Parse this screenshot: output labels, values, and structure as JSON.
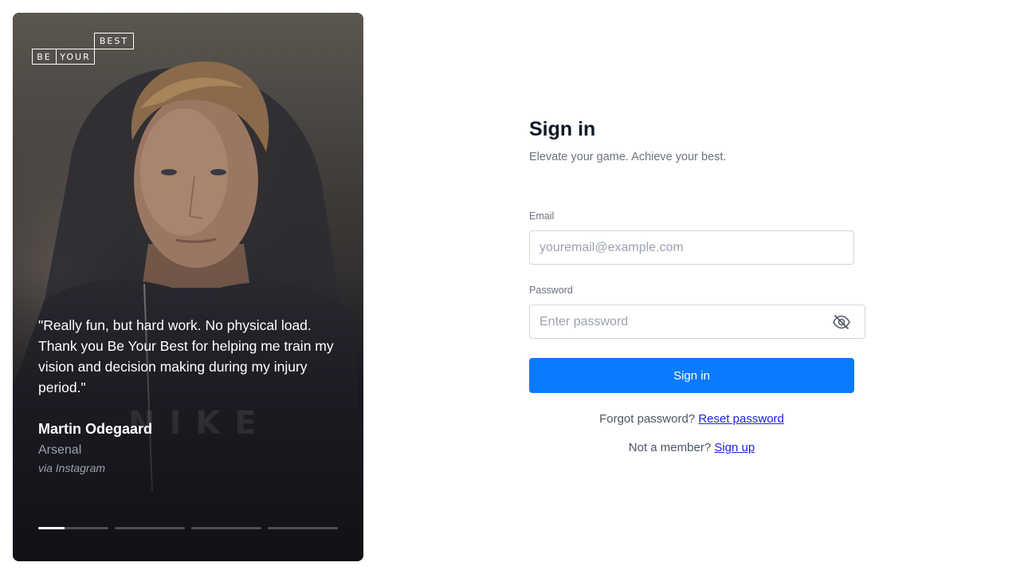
{
  "hero": {
    "logo": {
      "top": "BEST",
      "left": "BE",
      "middle": "YOUR"
    },
    "quote": "\"Really fun, but hard work. No physical load. Thank you Be Your Best for helping me train my vision and decision making during my injury period.\"",
    "author": {
      "name": "Martin Odegaard",
      "club": "Arsenal",
      "source": "via Instagram"
    },
    "carousel": {
      "total": 4,
      "active_index": 0,
      "active_progress": 0.38
    }
  },
  "form": {
    "title": "Sign in",
    "subtitle": "Elevate your game. Achieve your best.",
    "email": {
      "label": "Email",
      "placeholder": "youremail@example.com",
      "value": ""
    },
    "password": {
      "label": "Password",
      "placeholder": "Enter password",
      "value": "",
      "toggle_icon": "eye-slash-icon"
    },
    "submit_label": "Sign in",
    "forgot": {
      "text": "Forgot password?",
      "link": "Reset password"
    },
    "signup": {
      "text": "Not a member?",
      "link": "Sign up"
    }
  },
  "colors": {
    "primary": "#0a7bff",
    "link": "#1d24e0",
    "muted": "#6b7280",
    "heading": "#111827"
  }
}
